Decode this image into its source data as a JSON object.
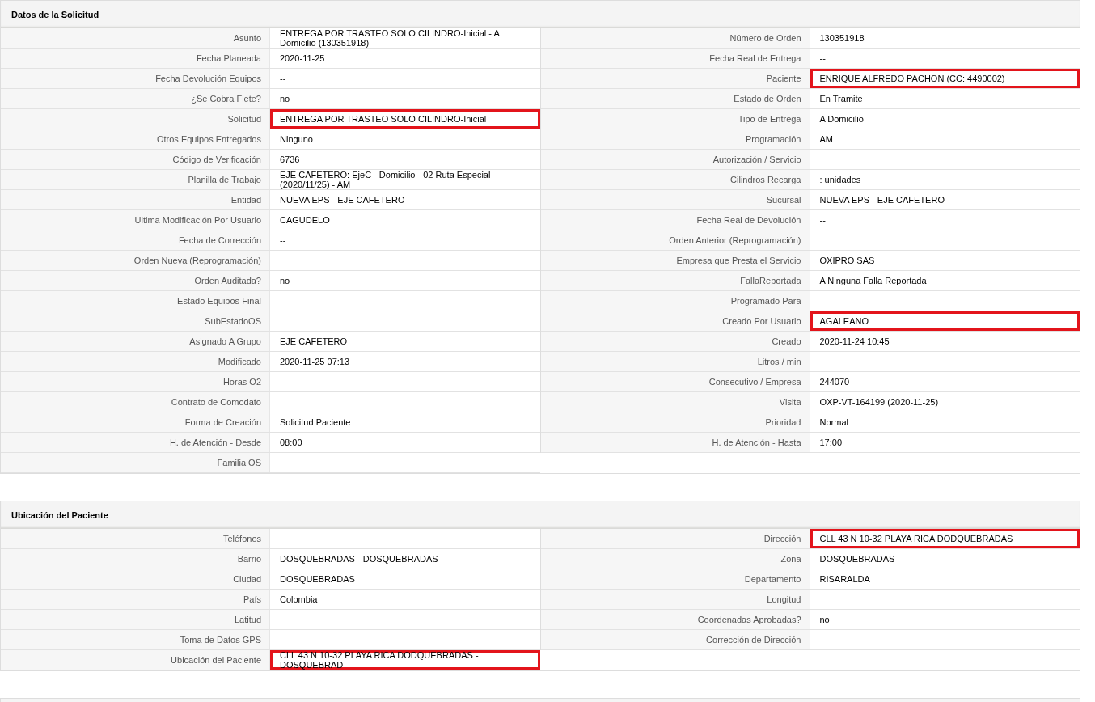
{
  "sections": [
    {
      "title": "Datos de la Solicitud",
      "columns": [
        [
          {
            "label": "Asunto",
            "value": "ENTREGA POR TRASTEO SOLO CILINDRO-Inicial - A Domicilio (130351918)",
            "highlighted": false
          },
          {
            "label": "Fecha Planeada",
            "value": "2020-11-25",
            "highlighted": false
          },
          {
            "label": "Fecha Devolución Equipos",
            "value": "--",
            "highlighted": false
          },
          {
            "label": "¿Se Cobra Flete?",
            "value": "no",
            "highlighted": false
          },
          {
            "label": "Solicitud",
            "value": "ENTREGA POR TRASTEO SOLO CILINDRO-Inicial",
            "highlighted": true
          },
          {
            "label": "Otros Equipos Entregados",
            "value": "Ninguno",
            "highlighted": false
          },
          {
            "label": "Código de Verificación",
            "value": "6736",
            "highlighted": false
          },
          {
            "label": "Planilla de Trabajo",
            "value": "EJE CAFETERO: EjeC - Domicilio - 02 Ruta Especial (2020/11/25) - AM",
            "highlighted": false
          },
          {
            "label": "Entidad",
            "value": "NUEVA EPS - EJE CAFETERO",
            "highlighted": false
          },
          {
            "label": "Ultima Modificación Por Usuario",
            "value": "CAGUDELO",
            "highlighted": false
          },
          {
            "label": "Fecha de Corrección",
            "value": "--",
            "highlighted": false
          },
          {
            "label": "Orden Nueva (Reprogramación)",
            "highlighted": false
          },
          {
            "label": "Orden Auditada?",
            "value": "no",
            "highlighted": false
          },
          {
            "label": "Estado Equipos Final",
            "highlighted": false
          },
          {
            "label": "SubEstadoOS",
            "highlighted": false
          },
          {
            "label": "Asignado A Grupo",
            "value": "EJE CAFETERO",
            "highlighted": false
          },
          {
            "label": "Modificado",
            "value": "2020-11-25 07:13",
            "highlighted": false
          },
          {
            "label": "Horas O2",
            "highlighted": false
          },
          {
            "label": "Contrato de Comodato",
            "highlighted": false
          },
          {
            "label": "Forma de Creación",
            "value": "Solicitud Paciente",
            "highlighted": false
          },
          {
            "label": "H. de Atención - Desde",
            "value": "08:00",
            "highlighted": false
          },
          {
            "label": "Familia OS",
            "highlighted": false
          }
        ],
        [
          {
            "label": "Número de Orden",
            "value": "130351918",
            "highlighted": false
          },
          {
            "label": "Fecha Real de Entrega",
            "value": "--",
            "highlighted": false
          },
          {
            "label": "Paciente",
            "value": "ENRIQUE ALFREDO PACHON (CC: 4490002)",
            "highlighted": true
          },
          {
            "label": "Estado de Orden",
            "value": "En Tramite",
            "highlighted": false
          },
          {
            "label": "Tipo de Entrega",
            "value": "A Domicilio",
            "highlighted": false
          },
          {
            "label": "Programación",
            "value": "AM",
            "highlighted": false
          },
          {
            "label": "Autorización / Servicio",
            "highlighted": false
          },
          {
            "label": "Cilindros Recarga",
            "value": ": unidades",
            "highlighted": false
          },
          {
            "label": "Sucursal",
            "value": "NUEVA EPS - EJE CAFETERO",
            "highlighted": false
          },
          {
            "label": "Fecha Real de Devolución",
            "value": "--",
            "highlighted": false
          },
          {
            "label": "Orden Anterior (Reprogramación)",
            "highlighted": false
          },
          {
            "label": "Empresa que Presta el Servicio",
            "value": "OXIPRO SAS",
            "highlighted": false
          },
          {
            "label": "FallaReportada",
            "value": "A Ninguna Falla Reportada",
            "highlighted": false
          },
          {
            "label": "Programado Para",
            "highlighted": false
          },
          {
            "label": "Creado Por Usuario",
            "value": "AGALEANO",
            "highlighted": true
          },
          {
            "label": "Creado",
            "value": "2020-11-24 10:45",
            "highlighted": false
          },
          {
            "label": "Litros / min",
            "highlighted": false
          },
          {
            "label": "Consecutivo / Empresa",
            "value": "244070",
            "highlighted": false
          },
          {
            "label": "Visita",
            "value": "OXP-VT-164199 (2020-11-25)",
            "highlighted": false
          },
          {
            "label": "Prioridad",
            "value": "Normal",
            "highlighted": false
          },
          {
            "label": "H. de Atención - Hasta",
            "value": "17:00",
            "highlighted": false
          }
        ]
      ]
    },
    {
      "title": "Ubicación del Paciente",
      "columns": [
        [
          {
            "label": "Teléfonos",
            "highlighted": false
          },
          {
            "label": "Barrio",
            "value": "DOSQUEBRADAS - DOSQUEBRADAS",
            "highlighted": false
          },
          {
            "label": "Ciudad",
            "value": "DOSQUEBRADAS",
            "highlighted": false
          },
          {
            "label": "País",
            "value": "Colombia",
            "highlighted": false
          },
          {
            "label": "Latitud",
            "highlighted": false
          },
          {
            "label": "Toma de Datos GPS",
            "highlighted": false
          },
          {
            "label": "Ubicación del Paciente",
            "value": "CLL 43 N 10-32 PLAYA RICA DODQUEBRADAS - DOSQUEBRAD",
            "highlighted": true
          }
        ],
        [
          {
            "label": "Dirección",
            "value": "CLL 43 N 10-32 PLAYA RICA DODQUEBRADAS",
            "highlighted": true
          },
          {
            "label": "Zona",
            "value": "DOSQUEBRADAS",
            "highlighted": false
          },
          {
            "label": "Departamento",
            "value": "RISARALDA",
            "highlighted": false
          },
          {
            "label": "Longitud",
            "highlighted": false
          },
          {
            "label": "Coordenadas Aprobadas?",
            "value": "no",
            "highlighted": false
          },
          {
            "label": "Corrección de Dirección",
            "highlighted": false
          }
        ]
      ]
    }
  ]
}
